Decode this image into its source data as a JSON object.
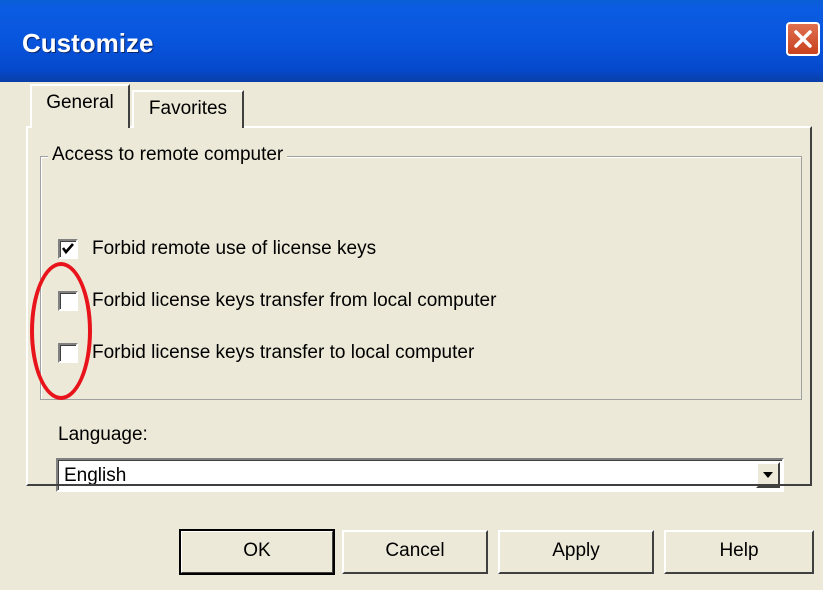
{
  "window": {
    "title": "Customize"
  },
  "tabs": [
    {
      "label": "General",
      "active": true
    },
    {
      "label": "Favorites",
      "active": false
    }
  ],
  "group": {
    "legend": "Access to remote computer",
    "options": [
      {
        "label": "Forbid remote use of license keys",
        "checked": true
      },
      {
        "label": "Forbid license keys transfer from local computer",
        "checked": false
      },
      {
        "label": "Forbid license keys transfer to local computer",
        "checked": false
      }
    ]
  },
  "language": {
    "label": "Language:",
    "selected": "English"
  },
  "buttons": {
    "ok": "OK",
    "cancel": "Cancel",
    "apply": "Apply",
    "help": "Help"
  },
  "colors": {
    "titlebar": "#0855dd",
    "close": "#d4532f",
    "face": "#ece9d8",
    "annotation": "#e8131b"
  },
  "icons": {
    "close": "close-icon",
    "check": "checkmark-icon",
    "dropdown": "chevron-down-icon"
  }
}
